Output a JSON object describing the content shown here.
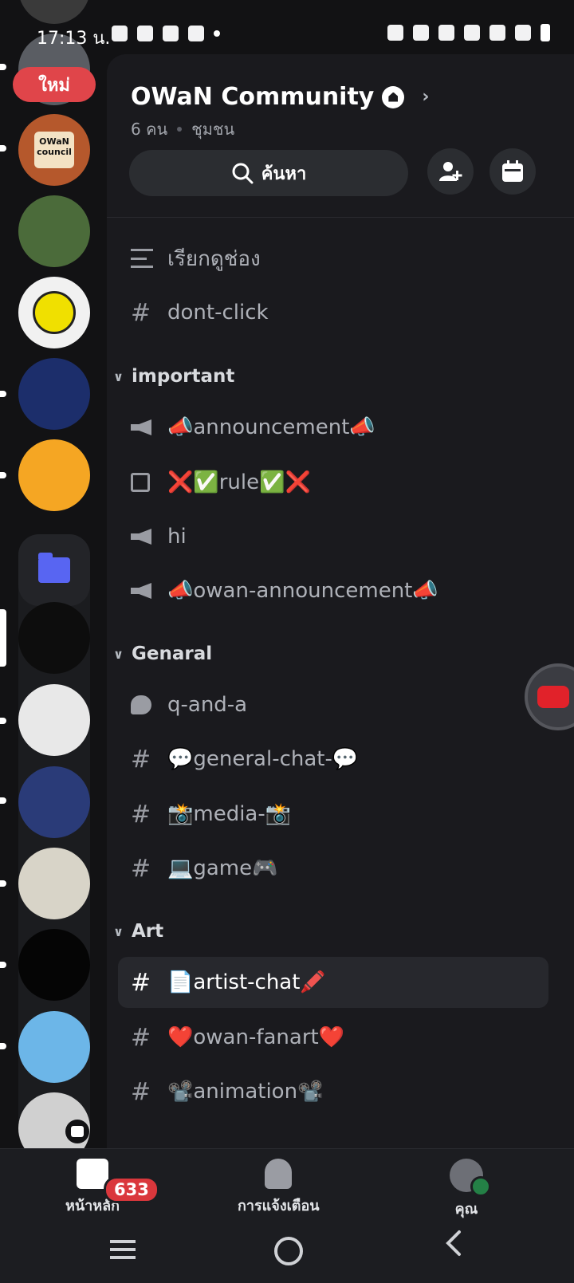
{
  "status_bar": {
    "time": "17:13 น."
  },
  "new_badge": "ใหม่",
  "server": {
    "name": "OWaN Community",
    "member_count": "6 คน",
    "type": "ชุมชน"
  },
  "search": {
    "label": "ค้นหา"
  },
  "top_channels": [
    {
      "icon": "browse-channels-icon",
      "label": "เรียกดูช่อง"
    },
    {
      "icon": "hash-icon",
      "label": "dont-click"
    }
  ],
  "categories": [
    {
      "name": "important",
      "channels": [
        {
          "icon": "megaphone-icon",
          "label": "📣announcement📣"
        },
        {
          "icon": "rules-icon",
          "label": "❌✅rule✅❌"
        },
        {
          "icon": "megaphone-icon",
          "label": "hi"
        },
        {
          "icon": "megaphone-icon",
          "label": "📣owan-announcement📣"
        }
      ]
    },
    {
      "name": "Genaral",
      "channels": [
        {
          "icon": "forum-icon",
          "label": "q-and-a"
        },
        {
          "icon": "hash-icon",
          "label": "💬general-chat-💬"
        },
        {
          "icon": "hash-icon",
          "label": "📸media-📸"
        },
        {
          "icon": "hash-icon",
          "label": "💻game🎮"
        }
      ]
    },
    {
      "name": "Art",
      "channels": [
        {
          "icon": "hash-icon",
          "label": "📄artist-chat🖍️",
          "active": true
        },
        {
          "icon": "hash-icon",
          "label": "❤️owan-fanart❤️"
        },
        {
          "icon": "hash-icon",
          "label": "📽️animation📽️"
        }
      ]
    }
  ],
  "server_icon_text": "OWaN council",
  "bottom_nav": {
    "home_label": "หน้าหลัก",
    "home_badge": "633",
    "notifications_label": "การแจ้งเตือน",
    "you_label": "คุณ"
  },
  "colors": {
    "accent": "#5865f2",
    "badge": "#da373c",
    "online": "#248046"
  }
}
